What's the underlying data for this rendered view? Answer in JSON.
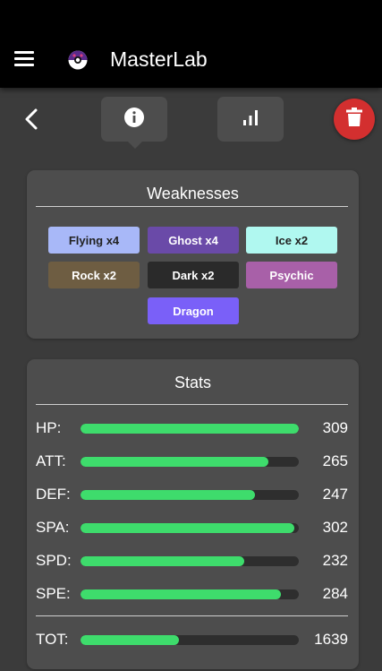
{
  "appbar": {
    "title": "MasterLab",
    "logo_icon": "pokeball-icon",
    "menu_icon": "hamburger-menu-icon"
  },
  "toolbar": {
    "back_icon": "chevron-left-icon",
    "info_icon": "info-icon",
    "stats_icon": "bar-chart-icon",
    "delete_icon": "trash-icon",
    "delete_color": "#d32f2f"
  },
  "weaknesses": {
    "title": "Weaknesses",
    "chips": [
      {
        "label": "Flying x4",
        "bg": "#a8b8f8",
        "fg": "#222222"
      },
      {
        "label": "Ghost x4",
        "bg": "#6a4aa8",
        "fg": "#ffffff"
      },
      {
        "label": "Ice x2",
        "bg": "#b0f8f0",
        "fg": "#222222"
      },
      {
        "label": "Rock x2",
        "bg": "#6e5d42",
        "fg": "#ffffff"
      },
      {
        "label": "Dark x2",
        "bg": "#2a2a2a",
        "fg": "#ffffff"
      },
      {
        "label": "Psychic",
        "bg": "#a860a8",
        "fg": "#ffffff"
      },
      {
        "label": "Dragon",
        "bg": "#7a60f8",
        "fg": "#ffffff"
      }
    ]
  },
  "stats": {
    "title": "Stats",
    "bar_color": "#3edc6c",
    "rows": [
      {
        "label": "HP:",
        "value": "309",
        "fill": 1.0
      },
      {
        "label": "ATT:",
        "value": "265",
        "fill": 0.86
      },
      {
        "label": "DEF:",
        "value": "247",
        "fill": 0.8
      },
      {
        "label": "SPA:",
        "value": "302",
        "fill": 0.98
      },
      {
        "label": "SPD:",
        "value": "232",
        "fill": 0.75
      },
      {
        "label": "SPE:",
        "value": "284",
        "fill": 0.92
      }
    ],
    "total": {
      "label": "TOT:",
      "value": "1639",
      "fill": 0.45
    }
  }
}
